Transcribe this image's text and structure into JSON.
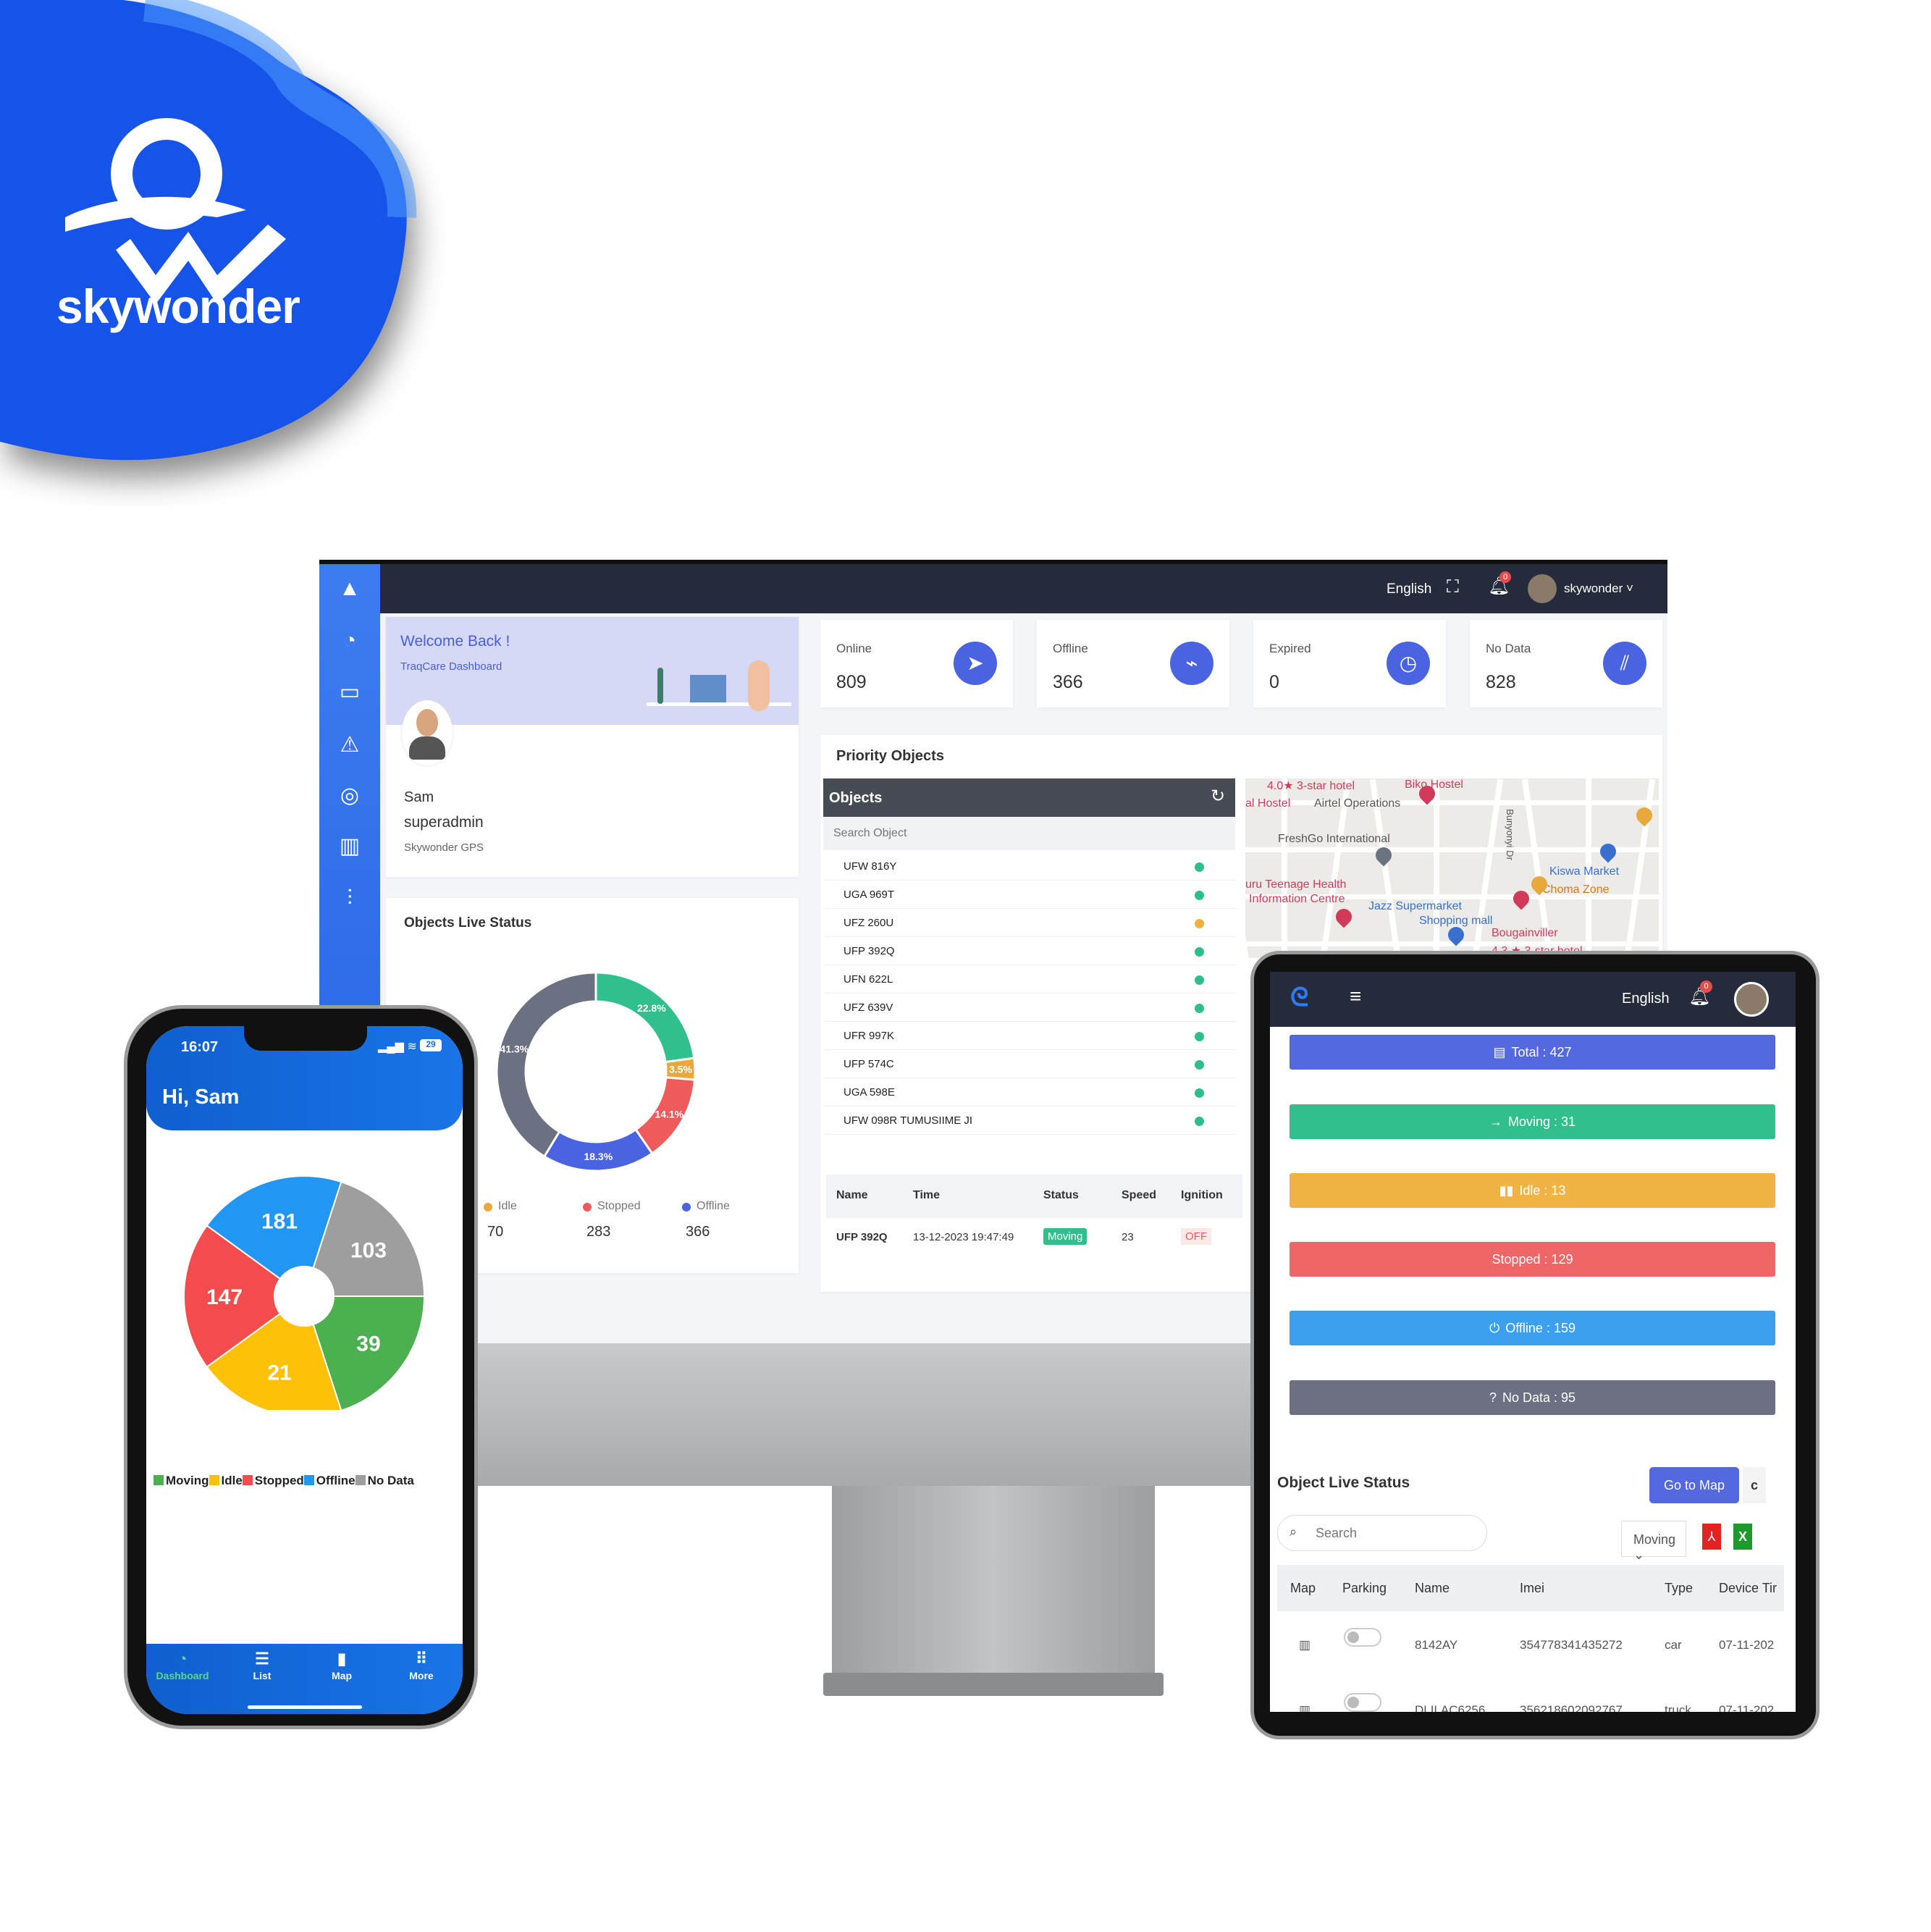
{
  "brand": {
    "name": "skywonder",
    "color": "#1a5ff0"
  },
  "desktop": {
    "topbar": {
      "language": "English",
      "notification_count": "0",
      "username": "skywonder",
      "icons": [
        "fullscreen-icon",
        "bell-icon",
        "avatar"
      ]
    },
    "sidebar": {
      "icons": [
        "logo-icon",
        "dashboard-gauge-icon",
        "monitor-icon",
        "alert-triangle-icon",
        "user-circle-icon",
        "bar-chart-icon",
        "sliders-icon"
      ]
    },
    "welcome": {
      "title": "Welcome Back !",
      "subtitle": "TraqCare Dashboard",
      "name": "Sam",
      "role": "superadmin",
      "company": "Skywonder GPS"
    },
    "stats": [
      {
        "label": "Online",
        "value": "809",
        "icon": "send-icon"
      },
      {
        "label": "Offline",
        "value": "366",
        "icon": "wifi-off-icon"
      },
      {
        "label": "Expired",
        "value": "0",
        "icon": "clock-icon"
      },
      {
        "label": "No Data",
        "value": "828",
        "icon": "signal-off-icon"
      }
    ],
    "priority": {
      "title": "Priority Objects",
      "objects_header": "Objects",
      "search_placeholder": "Search Object",
      "objects": [
        {
          "name": "UFW 816Y",
          "status": "#2fbf8a"
        },
        {
          "name": "UGA 969T",
          "status": "#2fbf8a"
        },
        {
          "name": "UFZ 260U",
          "status": "#f0b03f"
        },
        {
          "name": "UFP 392Q",
          "status": "#2fbf8a"
        },
        {
          "name": "UFN 622L",
          "status": "#2fbf8a"
        },
        {
          "name": "UFZ 639V",
          "status": "#2fbf8a"
        },
        {
          "name": "UFR 997K",
          "status": "#2fbf8a"
        },
        {
          "name": "UFP 574C",
          "status": "#2fbf8a"
        },
        {
          "name": "UGA 598E",
          "status": "#2fbf8a"
        },
        {
          "name": "UFW 098R TUMUSIIME JI",
          "status": "#2fbf8a"
        }
      ],
      "table": {
        "headers": [
          "Name",
          "Time",
          "Status",
          "Speed",
          "Ignition"
        ],
        "rows": [
          [
            "UFP 392Q",
            "13-12-2023 19:47:49",
            "Moving",
            "23",
            "OFF"
          ]
        ]
      },
      "map_labels": [
        "4.0★ 3-star hotel",
        "Biko Hostel",
        "al Hostel",
        "Airtel Operations",
        "FreshGo International",
        "Bunyonyi Dr",
        "Kiswa Market",
        "Choma Zone",
        "uru Teenage Health",
        "Information Centre",
        "Jazz Supermarket",
        "Shopping mall",
        "Bougainviller",
        "4.3 ★ 3-star hotel"
      ]
    },
    "live_status": {
      "title": "Objects Live Status",
      "legend": [
        {
          "label": "Idle",
          "value": "70",
          "color": "#e8a93a"
        },
        {
          "label": "Stopped",
          "value": "283",
          "color": "#ef5b5b"
        },
        {
          "label": "Offline",
          "value": "366",
          "color": "#4a63e0"
        }
      ]
    }
  },
  "chart_data": [
    {
      "type": "pie",
      "variant": "donut",
      "labels_shown": [
        "22.8%",
        "3.5%",
        "14.1%",
        "18.3%",
        "41.3%"
      ],
      "slices": [
        {
          "value": 22.8,
          "color": "#2fc08d"
        },
        {
          "value": 3.5,
          "color": "#e8a93a"
        },
        {
          "value": 14.1,
          "color": "#ef5b5b"
        },
        {
          "value": 18.3,
          "color": "#4a63e0"
        },
        {
          "value": 41.3,
          "color": "#6c7182"
        }
      ]
    },
    {
      "type": "pie",
      "legend_position": "bottom",
      "slices": [
        {
          "name": "Moving",
          "value": 39,
          "color": "#4caf50"
        },
        {
          "name": "Idle",
          "value": 21,
          "color": "#ffc107"
        },
        {
          "name": "Stopped",
          "value": 147,
          "color": "#f44c4c"
        },
        {
          "name": "Offline",
          "value": 181,
          "color": "#2196f3"
        },
        {
          "name": "No Data",
          "value": 103,
          "color": "#9e9e9e"
        }
      ]
    }
  ],
  "phone": {
    "time": "16:07",
    "battery": "29",
    "greeting": "Hi, Sam",
    "nav": [
      {
        "label": "Dashboard",
        "icon": "◔",
        "active": true
      },
      {
        "label": "List",
        "icon": "☰"
      },
      {
        "label": "Map",
        "icon": "▮"
      },
      {
        "label": "More",
        "icon": "⠿"
      }
    ]
  },
  "tablet": {
    "language": "English",
    "notification_count": "0",
    "status_buttons": [
      {
        "label": "Total : 427",
        "icon": "▤",
        "color": "#5468e0"
      },
      {
        "label": "Moving : 31",
        "icon": "→",
        "color": "#2fc08d"
      },
      {
        "label": "Idle : 13",
        "icon": "▮▮",
        "color": "#f0b444"
      },
      {
        "label": "Stopped : 129",
        "icon": "",
        "color": "#f06565"
      },
      {
        "label": "Offline : 159",
        "icon": "⏻",
        "color": "#3aa0ef"
      },
      {
        "label": "No Data : 95",
        "icon": "?",
        "color": "#6c7082"
      }
    ],
    "live": {
      "title": "Object Live Status",
      "go_to_map": "Go to Map",
      "refresh": "c",
      "search_placeholder": "Search",
      "filter": "Moving",
      "headers": [
        "Map",
        "Parking",
        "Name",
        "Imei",
        "Type",
        "Device Tir"
      ],
      "rows": [
        {
          "name": "8142AY",
          "imei": "354778341435272",
          "type": "car",
          "device_time": "07-11-202"
        },
        {
          "name": "DLILAC6256",
          "imei": "356218602092767",
          "type": "truck",
          "device_time": "07-11-202"
        }
      ]
    }
  }
}
